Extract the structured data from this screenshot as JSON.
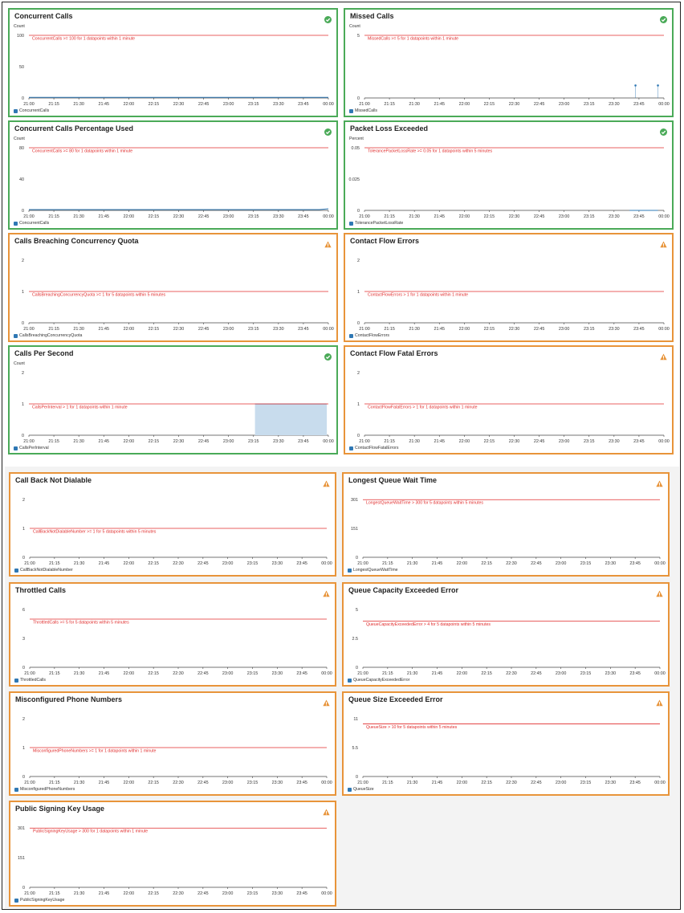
{
  "colors": {
    "ok": "#4aaa58",
    "warn": "#e8943a",
    "threshold": "#e02b2b",
    "series": "#2f78b4",
    "fill": "#c8dced"
  },
  "time_ticks": [
    "21:00",
    "21:15",
    "21:30",
    "21:45",
    "22:00",
    "22:15",
    "22:30",
    "22:45",
    "23:00",
    "23:15",
    "23:30",
    "23:45",
    "00:00"
  ],
  "chart_data": [
    {
      "type": "line",
      "title": "Concurrent Calls",
      "status": "ok",
      "ylabel": "Count",
      "yticks": [
        "100",
        "50",
        "0"
      ],
      "ylim": [
        0,
        100
      ],
      "threshold": {
        "value": 100,
        "label": "ConcurrentCalls >= 100 for 1 datapoints within 1 minute"
      },
      "series": [
        {
          "name": "ConcurrentCalls",
          "points": [
            [
              0.0,
              1
            ],
            [
              0.1,
              1
            ],
            [
              0.15,
              1
            ],
            [
              0.83,
              1
            ],
            [
              0.92,
              1
            ],
            [
              0.97,
              1
            ],
            [
              1.0,
              1
            ]
          ]
        }
      ]
    },
    {
      "type": "scatter",
      "title": "Missed Calls",
      "status": "ok",
      "ylabel": "Count",
      "yticks": [
        "5",
        "0"
      ],
      "ylim": [
        0,
        5
      ],
      "threshold": {
        "value": 5,
        "label": "MissedCalls >= 5 for 1 datapoints within 1 minute"
      },
      "series": [
        {
          "name": "MissedCalls",
          "points": [
            [
              0.905,
              1
            ],
            [
              0.98,
              1
            ]
          ]
        }
      ]
    },
    {
      "type": "line",
      "title": "Concurrent Calls Percentage Used",
      "status": "ok",
      "ylabel": "Count",
      "yticks": [
        "80",
        "40",
        "0"
      ],
      "ylim": [
        0,
        80
      ],
      "threshold": {
        "value": 80,
        "label": "ConcurrentCalls >= 80 for 1 datapoints within 1 minute"
      },
      "series": [
        {
          "name": "ConcurrentCalls",
          "points": [
            [
              0.0,
              1
            ],
            [
              0.1,
              1
            ],
            [
              0.15,
              1
            ],
            [
              0.83,
              1
            ],
            [
              0.92,
              1
            ],
            [
              0.97,
              1
            ],
            [
              1.0,
              2
            ]
          ]
        }
      ]
    },
    {
      "type": "line",
      "title": "Packet Loss Exceeded",
      "status": "ok",
      "ylabel": "Percent",
      "yticks": [
        "0.05",
        "0.025",
        "0"
      ],
      "ylim": [
        0,
        0.05
      ],
      "threshold": {
        "value": 0.05,
        "label": "TolerancePacketLossRate >= 0.05 for 1 datapoints within 5 minutes"
      },
      "series": [
        {
          "name": "TolerancePacketLossRate",
          "points": [
            [
              0.885,
              0
            ],
            [
              0.98,
              0
            ]
          ]
        }
      ]
    },
    {
      "type": "line",
      "title": "Calls Breaching Concurrency Quota",
      "status": "warn",
      "ylabel": "",
      "yticks": [
        "2",
        "1",
        "0"
      ],
      "ylim": [
        0,
        2
      ],
      "threshold": {
        "value": 1,
        "label": "CallsBreachingConcurrencyQuota >= 1 for 5 datapoints within 5 minutes"
      },
      "series": [
        {
          "name": "CallsBreachingConcurrencyQuota",
          "points": []
        }
      ]
    },
    {
      "type": "line",
      "title": "Contact Flow Errors",
      "status": "warn",
      "ylabel": "",
      "yticks": [
        "2",
        "1",
        "0"
      ],
      "ylim": [
        0,
        2
      ],
      "threshold": {
        "value": 1,
        "label": "ContactFlowErrors > 1 for 1 datapoints within 1 minute"
      },
      "series": [
        {
          "name": "ContactFlowErrors",
          "points": []
        }
      ]
    },
    {
      "type": "area",
      "title": "Calls Per Second",
      "status": "ok",
      "ylabel": "Count",
      "yticks": [
        "2",
        "1",
        "0"
      ],
      "ylim": [
        0,
        2
      ],
      "threshold": {
        "value": 1,
        "label": "CallsPerInterval > 1 for 1 datapoints within 1 minute"
      },
      "series": [
        {
          "name": "CallsPerInterval",
          "points": [
            [
              0.755,
              0
            ],
            [
              0.755,
              1
            ],
            [
              0.995,
              1
            ],
            [
              0.995,
              0
            ]
          ]
        }
      ]
    },
    {
      "type": "line",
      "title": "Contact Flow Fatal Errors",
      "status": "warn",
      "ylabel": "",
      "yticks": [
        "2",
        "1",
        "0"
      ],
      "ylim": [
        0,
        2
      ],
      "threshold": {
        "value": 1,
        "label": "ContactFlowFatalErrors > 1 for 1 datapoints within 1 minute"
      },
      "series": [
        {
          "name": "ContactFlowFatalErrors",
          "points": []
        }
      ]
    },
    {
      "type": "line",
      "title": "Call Back Not Dialable",
      "status": "warn",
      "ylabel": "",
      "yticks": [
        "2",
        "1",
        "0"
      ],
      "ylim": [
        0,
        2
      ],
      "threshold": {
        "value": 1,
        "label": "CallBackNotDialableNumber >= 1 for 5 datapoints within 5 minutes"
      },
      "series": [
        {
          "name": "CallBackNotDialableNumber",
          "points": []
        }
      ]
    },
    {
      "type": "line",
      "title": "Longest Queue Wait Time",
      "status": "warn",
      "ylabel": "",
      "yticks": [
        "301",
        "151",
        "0"
      ],
      "ylim": [
        0,
        301
      ],
      "threshold": {
        "value": 300,
        "label": "LongestQueueWaitTime > 300 for 5 datapoints within 5 minutes"
      },
      "series": [
        {
          "name": "LongestQueueWaitTime",
          "points": []
        }
      ]
    },
    {
      "type": "line",
      "title": "Throttled Calls",
      "status": "warn",
      "ylabel": "",
      "yticks": [
        "6",
        "3",
        "0"
      ],
      "ylim": [
        0,
        6
      ],
      "threshold": {
        "value": 5,
        "label": "ThrottledCalls >= 5 for 5 datapoints within 5 minutes"
      },
      "series": [
        {
          "name": "ThrottledCalls",
          "points": []
        }
      ]
    },
    {
      "type": "line",
      "title": "Queue Capacity Exceeded Error",
      "status": "warn",
      "ylabel": "",
      "yticks": [
        "5",
        "2.5",
        "0"
      ],
      "ylim": [
        0,
        5
      ],
      "threshold": {
        "value": 4,
        "label": "QueueCapacityExceededError > 4 for 5 datapoints within 5 minutes"
      },
      "series": [
        {
          "name": "QueueCapacityExceededError",
          "points": []
        }
      ]
    },
    {
      "type": "line",
      "title": "Misconfigured Phone Numbers",
      "status": "warn",
      "ylabel": "",
      "yticks": [
        "2",
        "1",
        "0"
      ],
      "ylim": [
        0,
        2
      ],
      "threshold": {
        "value": 1,
        "label": "MisconfiguredPhoneNumbers >= 1 for 1 datapoints within 1 minute"
      },
      "series": [
        {
          "name": "MisconfiguredPhoneNumbers",
          "points": []
        }
      ]
    },
    {
      "type": "line",
      "title": "Queue Size Exceeded Error",
      "status": "warn",
      "ylabel": "",
      "yticks": [
        "11",
        "5.5",
        "0"
      ],
      "ylim": [
        0,
        11
      ],
      "threshold": {
        "value": 10,
        "label": "QueueSize > 10 for 5 datapoints within 5 minutes"
      },
      "series": [
        {
          "name": "QueueSize",
          "points": []
        }
      ]
    },
    {
      "type": "line",
      "title": "Public Signing Key Usage",
      "status": "warn",
      "ylabel": "",
      "yticks": [
        "301",
        "151",
        "0"
      ],
      "ylim": [
        0,
        301
      ],
      "threshold": {
        "value": 300,
        "label": "PublicSigningKeyUsage > 300 for 1 datapoints within 1 minute"
      },
      "series": [
        {
          "name": "PublicSigningKeyUsage",
          "points": []
        }
      ]
    }
  ]
}
